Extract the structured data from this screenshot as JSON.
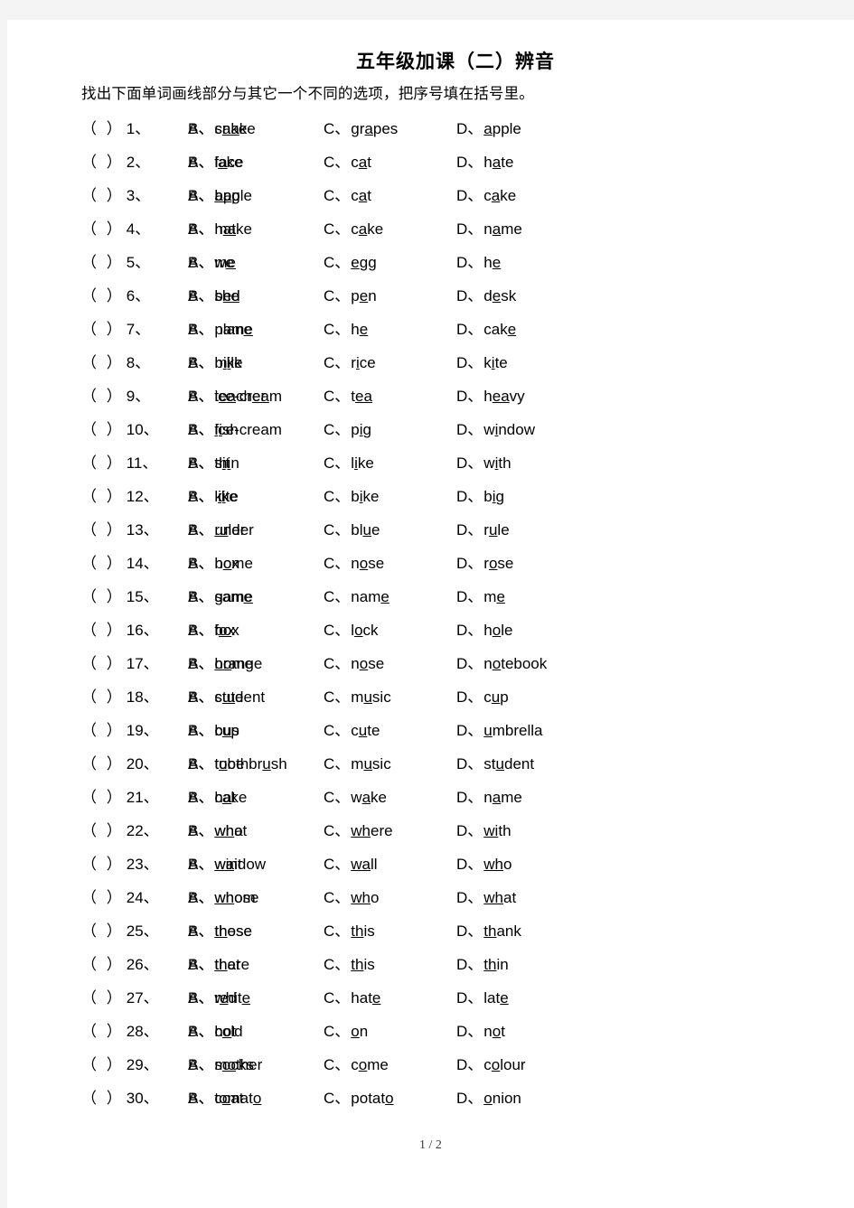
{
  "document": {
    "title": "五年级加课（二）辨音",
    "instruction": "找出下面单词画线部分与其它一个不同的选项，把序号填在括号里。",
    "answer_blank": "（  ）",
    "num_suffix": "、",
    "option_letters": [
      "A",
      "B",
      "C",
      "D"
    ],
    "option_separator": "、",
    "footer": "1 / 2"
  },
  "questions": [
    {
      "number": "1",
      "options": [
        [
          "c",
          "a",
          "ke"
        ],
        [
          "sn",
          "a",
          "ke"
        ],
        [
          "gr",
          "a",
          "pes"
        ],
        [
          "",
          "a",
          "pple"
        ]
      ]
    },
    {
      "number": "2",
      "options": [
        [
          "f",
          "a",
          "ce"
        ],
        [
          "l",
          "a",
          "ke"
        ],
        [
          "c",
          "a",
          "t"
        ],
        [
          "h",
          "a",
          "te"
        ]
      ]
    },
    {
      "number": "3",
      "options": [
        [
          "",
          "a",
          "pple"
        ],
        [
          "b",
          "a",
          "g"
        ],
        [
          "c",
          "a",
          "t"
        ],
        [
          "c",
          "a",
          "ke"
        ]
      ]
    },
    {
      "number": "4",
      "options": [
        [
          "h",
          "a",
          "t"
        ],
        [
          "m",
          "a",
          "ke"
        ],
        [
          "c",
          "a",
          "ke"
        ],
        [
          "n",
          "a",
          "me"
        ]
      ]
    },
    {
      "number": "5",
      "options": [
        [
          "w",
          "e",
          ""
        ],
        [
          "m",
          "e",
          ""
        ],
        [
          "",
          "e",
          "gg"
        ],
        [
          "h",
          "e",
          ""
        ]
      ]
    },
    {
      "number": "6",
      "options": [
        [
          "sh",
          "e",
          ""
        ],
        [
          "b",
          "e",
          "d"
        ],
        [
          "p",
          "e",
          "n"
        ],
        [
          "d",
          "e",
          "sk"
        ]
      ]
    },
    {
      "number": "7",
      "options": [
        [
          "plan",
          "e",
          ""
        ],
        [
          "nam",
          "e",
          ""
        ],
        [
          "h",
          "e",
          ""
        ],
        [
          "cak",
          "e",
          ""
        ]
      ]
    },
    {
      "number": "8",
      "options": [
        [
          "b",
          "i",
          "ke"
        ],
        [
          "m",
          "i",
          "lk"
        ],
        [
          "r",
          "i",
          "ce"
        ],
        [
          "k",
          "i",
          "te"
        ]
      ]
    },
    {
      "number": "9",
      "options": [
        [
          "ice-cr",
          "ea",
          "m"
        ],
        [
          "t",
          "ea",
          "cher"
        ],
        [
          "t",
          "ea",
          ""
        ],
        [
          "h",
          "ea",
          "vy"
        ]
      ]
    },
    {
      "number": "10",
      "options": [
        [
          "",
          "i",
          "ce-cream"
        ],
        [
          "f",
          "i",
          "sh"
        ],
        [
          "p",
          "i",
          "g"
        ],
        [
          "w",
          "i",
          "ndow"
        ]
      ]
    },
    {
      "number": "11",
      "options": [
        [
          "th",
          "i",
          "n"
        ],
        [
          "s",
          "i",
          "t"
        ],
        [
          "l",
          "i",
          "ke"
        ],
        [
          "w",
          "i",
          "th"
        ]
      ]
    },
    {
      "number": "12",
      "options": [
        [
          "k",
          "i",
          "te"
        ],
        [
          "l",
          "i",
          "ke"
        ],
        [
          "b",
          "i",
          "ke"
        ],
        [
          "b",
          "i",
          "g"
        ]
      ]
    },
    {
      "number": "13",
      "options": [
        [
          "",
          "u",
          "nder"
        ],
        [
          "r",
          "u",
          "ler"
        ],
        [
          "bl",
          "u",
          "e"
        ],
        [
          "r",
          "u",
          "le"
        ]
      ]
    },
    {
      "number": "14",
      "options": [
        [
          "h",
          "o",
          "me"
        ],
        [
          "b",
          "o",
          "x"
        ],
        [
          "n",
          "o",
          "se"
        ],
        [
          "r",
          "o",
          "se"
        ]
      ]
    },
    {
      "number": "15",
      "options": [
        [
          "gam",
          "e",
          ""
        ],
        [
          "sam",
          "e",
          ""
        ],
        [
          "nam",
          "e",
          ""
        ],
        [
          "m",
          "e",
          ""
        ]
      ]
    },
    {
      "number": "16",
      "options": [
        [
          "b",
          "o",
          "x"
        ],
        [
          "f",
          "o",
          "x"
        ],
        [
          "l",
          "o",
          "ck"
        ],
        [
          "h",
          "o",
          "le"
        ]
      ]
    },
    {
      "number": "17",
      "options": [
        [
          "",
          "o",
          "range"
        ],
        [
          "h",
          "o",
          "me"
        ],
        [
          "n",
          "o",
          "se"
        ],
        [
          "n",
          "o",
          "tebook"
        ]
      ]
    },
    {
      "number": "18",
      "options": [
        [
          "st",
          "u",
          "dent"
        ],
        [
          "c",
          "u",
          "te"
        ],
        [
          "m",
          "u",
          "sic"
        ],
        [
          "c",
          "u",
          "p"
        ]
      ]
    },
    {
      "number": "19",
      "options": [
        [
          "b",
          "u",
          "s"
        ],
        [
          "c",
          "u",
          "p"
        ],
        [
          "c",
          "u",
          "te"
        ],
        [
          "",
          "u",
          "mbrella"
        ]
      ]
    },
    {
      "number": "20",
      "options": [
        [
          "t",
          "u",
          "be"
        ],
        [
          "toothbr",
          "u",
          "sh"
        ],
        [
          "m",
          "u",
          "sic"
        ],
        [
          "st",
          "u",
          "dent"
        ]
      ]
    },
    {
      "number": "21",
      "options": [
        [
          "c",
          "a",
          "ke"
        ],
        [
          "h",
          "a",
          "t"
        ],
        [
          "w",
          "a",
          "ke"
        ],
        [
          "n",
          "a",
          "me"
        ]
      ]
    },
    {
      "number": "22",
      "options": [
        [
          "",
          "wh",
          "o"
        ],
        [
          "",
          "wh",
          "at"
        ],
        [
          "",
          "wh",
          "ere"
        ],
        [
          "",
          "wi",
          "th"
        ]
      ]
    },
    {
      "number": "23",
      "options": [
        [
          "",
          "wi",
          "ndow"
        ],
        [
          "",
          "wa",
          "it"
        ],
        [
          "",
          "wa",
          "ll"
        ],
        [
          "",
          "wh",
          "o"
        ]
      ]
    },
    {
      "number": "24",
      "options": [
        [
          "",
          "wh",
          "ose"
        ],
        [
          "",
          "wh",
          "om"
        ],
        [
          "",
          "wh",
          "o"
        ],
        [
          "",
          "wh",
          "at"
        ]
      ]
    },
    {
      "number": "25",
      "options": [
        [
          "",
          "th",
          "ese"
        ],
        [
          "",
          "th",
          "ose"
        ],
        [
          "",
          "th",
          "is"
        ],
        [
          "",
          "th",
          "ank"
        ]
      ]
    },
    {
      "number": "26",
      "options": [
        [
          "",
          "th",
          "at"
        ],
        [
          "",
          "th",
          "ere"
        ],
        [
          "",
          "th",
          "is"
        ],
        [
          "",
          "th",
          "in"
        ]
      ]
    },
    {
      "number": "27",
      "options": [
        [
          "r",
          "e",
          "d"
        ],
        [
          "whit",
          "e",
          ""
        ],
        [
          "hat",
          "e",
          ""
        ],
        [
          "lat",
          "e",
          ""
        ]
      ]
    },
    {
      "number": "28",
      "options": [
        [
          "h",
          "o",
          "t"
        ],
        [
          "c",
          "o",
          "ld"
        ],
        [
          "",
          "o",
          "n"
        ],
        [
          "n",
          "o",
          "t"
        ]
      ]
    },
    {
      "number": "29",
      "options": [
        [
          "m",
          "o",
          "ther"
        ],
        [
          "s",
          "o",
          "cks"
        ],
        [
          "c",
          "o",
          "me"
        ],
        [
          "c",
          "o",
          "lour"
        ]
      ]
    },
    {
      "number": "30",
      "options": [
        [
          "c",
          "o",
          "at"
        ],
        [
          "tomat",
          "o",
          ""
        ],
        [
          "potat",
          "o",
          ""
        ],
        [
          "",
          "o",
          "nion"
        ]
      ]
    }
  ]
}
